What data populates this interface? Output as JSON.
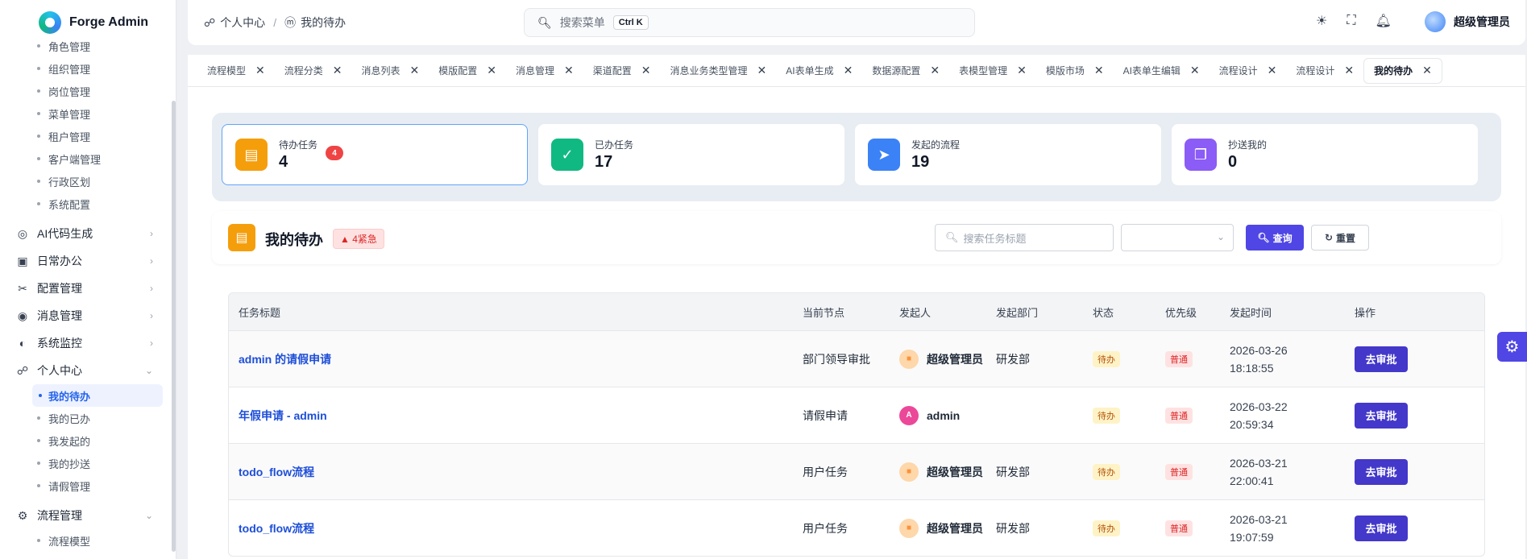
{
  "app": {
    "name": "Forge Admin"
  },
  "sidebar": {
    "top_subitems": [
      "角色管理",
      "组织管理",
      "岗位管理",
      "菜单管理",
      "租户管理",
      "客户端管理",
      "行政区划",
      "系统配置"
    ],
    "groups": [
      {
        "label": "AI代码生成",
        "icon": "ai-icon"
      },
      {
        "label": "日常办公",
        "icon": "briefcase-icon"
      },
      {
        "label": "配置管理",
        "icon": "tools-icon"
      },
      {
        "label": "消息管理",
        "icon": "message-icon"
      },
      {
        "label": "系统监控",
        "icon": "monitor-icon"
      }
    ],
    "personal": {
      "label": "个人中心",
      "icon": "person-icon"
    },
    "personal_items": [
      "我的待办",
      "我的已办",
      "我发起的",
      "我的抄送",
      "请假管理"
    ],
    "flow": {
      "label": "流程管理",
      "icon": "gear-icon"
    },
    "flow_items": [
      "流程模型"
    ]
  },
  "header": {
    "breadcrumb": [
      "个人中心",
      "我的待办"
    ],
    "search_placeholder": "搜索菜单",
    "search_shortcut": "Ctrl K",
    "user_name": "超级管理员"
  },
  "tabs": [
    "流程模型",
    "流程分类",
    "消息列表",
    "模版配置",
    "消息管理",
    "渠道配置",
    "消息业务类型管理",
    "AI表单生成",
    "数据源配置",
    "表模型管理",
    "模版市场",
    "AI表单生编辑",
    "流程设计",
    "流程设计",
    "我的待办"
  ],
  "stats": [
    {
      "label": "待办任务",
      "value": "4",
      "badge": "4",
      "color": "#f59e0b",
      "icon": "clipboard-icon"
    },
    {
      "label": "已办任务",
      "value": "17",
      "color": "#10b981",
      "icon": "check-icon"
    },
    {
      "label": "发起的流程",
      "value": "19",
      "color": "#3b82f6",
      "icon": "send-icon"
    },
    {
      "label": "抄送我的",
      "value": "0",
      "color": "#8b5cf6",
      "icon": "copy-icon"
    }
  ],
  "todo": {
    "title": "我的待办",
    "urgent": "4紧急",
    "search_placeholder": "搜索任务标题",
    "query_label": "查询",
    "reset_label": "重置"
  },
  "table": {
    "headers": [
      "任务标题",
      "当前节点",
      "发起人",
      "发起部门",
      "状态",
      "优先级",
      "发起时间",
      "操作"
    ],
    "rows": [
      {
        "title": "admin 的请假申请",
        "node": "部门领导审批",
        "initiator": "超级管理员",
        "avatar": "",
        "dept": "研发部",
        "status": "待办",
        "priority": "普通",
        "date": "2026-03-26",
        "time": "18:18:55",
        "action": "去审批"
      },
      {
        "title": "年假申请 - admin",
        "node": "请假申请",
        "initiator": "admin",
        "avatar": "A",
        "dept": "",
        "status": "待办",
        "priority": "普通",
        "date": "2026-03-22",
        "time": "20:59:34",
        "action": "去审批"
      },
      {
        "title": "todo_flow流程",
        "node": "用户任务",
        "initiator": "超级管理员",
        "avatar": "",
        "dept": "研发部",
        "status": "待办",
        "priority": "普通",
        "date": "2026-03-21",
        "time": "22:00:41",
        "action": "去审批"
      },
      {
        "title": "todo_flow流程",
        "node": "用户任务",
        "initiator": "超级管理员",
        "avatar": "",
        "dept": "研发部",
        "status": "待办",
        "priority": "普通",
        "date": "2026-03-21",
        "time": "19:07:59",
        "action": "去审批"
      }
    ]
  }
}
